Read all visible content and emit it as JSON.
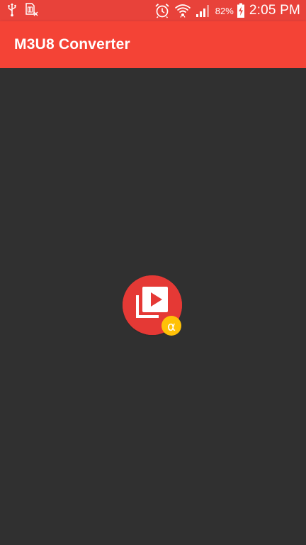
{
  "status_bar": {
    "battery_percent": "82%",
    "time": "2:05 PM",
    "icons": [
      "usb-icon",
      "sim-card-icon",
      "alarm-icon",
      "wifi-icon",
      "signal-icon",
      "battery-charging-icon"
    ]
  },
  "app_bar": {
    "title": "M3U8 Converter"
  },
  "center_logo": {
    "icon": "video-converter-logo-icon",
    "badge_letter": "α",
    "colors": {
      "circle": "#e53935",
      "badge": "#ffc107",
      "frame": "#ffffff"
    }
  },
  "colors": {
    "status_bar": "#e8423a",
    "app_bar": "#f44336",
    "background": "#303030"
  }
}
